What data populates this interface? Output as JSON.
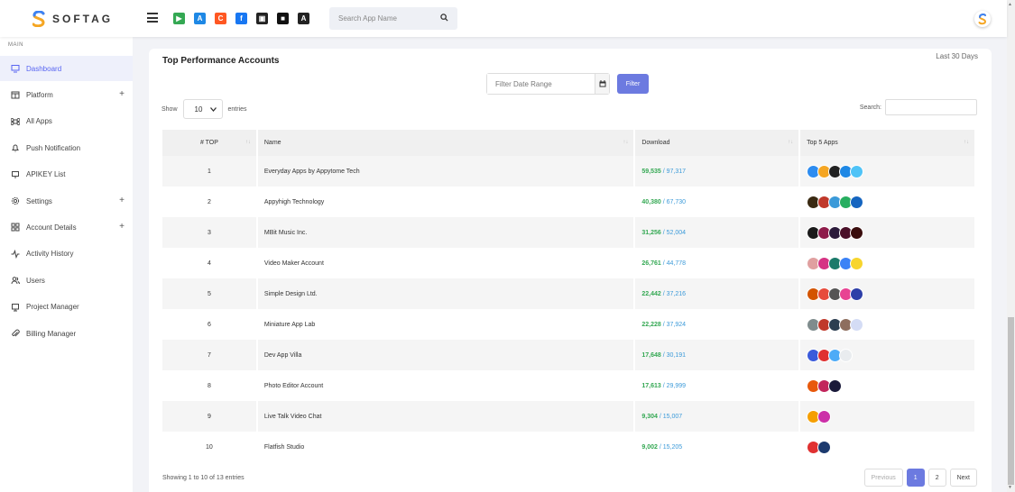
{
  "brand": {
    "name": "SOFTAG"
  },
  "header": {
    "search_placeholder": "Search App Name",
    "store_icons": [
      {
        "name": "google-play-icon",
        "color": "#34a853",
        "glyph": "▶"
      },
      {
        "name": "app-store-icon",
        "color": "#1e88e5",
        "glyph": "A"
      },
      {
        "name": "appgallery-icon",
        "color": "#ff5722",
        "glyph": "C"
      },
      {
        "name": "facebook-icon",
        "color": "#1877f2",
        "glyph": "f"
      },
      {
        "name": "windows-store-icon",
        "color": "#222222",
        "glyph": "▣"
      },
      {
        "name": "store-icon",
        "color": "#111111",
        "glyph": "■"
      },
      {
        "name": "amazon-store-icon",
        "color": "#222222",
        "glyph": "A"
      }
    ]
  },
  "sidebar": {
    "section": "MAIN",
    "items": [
      {
        "label": "Dashboard",
        "icon": "monitor-icon",
        "active": true,
        "expand": ""
      },
      {
        "label": "Platform",
        "icon": "grid-icon",
        "active": false,
        "expand": "+"
      },
      {
        "label": "All Apps",
        "icon": "command-icon",
        "active": false,
        "expand": ""
      },
      {
        "label": "Push Notification",
        "icon": "bell-icon",
        "active": false,
        "expand": ""
      },
      {
        "label": "APIKEY List",
        "icon": "key-icon",
        "active": false,
        "expand": ""
      },
      {
        "label": "Settings",
        "icon": "gear-icon",
        "active": false,
        "expand": "+"
      },
      {
        "label": "Account Details",
        "icon": "layout-icon",
        "active": false,
        "expand": "+"
      },
      {
        "label": "Activity History",
        "icon": "activity-icon",
        "active": false,
        "expand": ""
      },
      {
        "label": "Users",
        "icon": "users-icon",
        "active": false,
        "expand": ""
      },
      {
        "label": "Project Manager",
        "icon": "clipboard-icon",
        "active": false,
        "expand": ""
      },
      {
        "label": "Billing Manager",
        "icon": "paperclip-icon",
        "active": false,
        "expand": ""
      }
    ]
  },
  "card": {
    "title": "Top Performance Accounts",
    "subtitle": "Last 30 Days",
    "filter_placeholder": "Filter Date Range",
    "filter_button": "Filter",
    "show_label": "Show",
    "entries_value": "10",
    "entries_label": "entries",
    "search_label": "Search:"
  },
  "table": {
    "headers": [
      "# TOP",
      "Name",
      "Download",
      "Top 5 Apps"
    ],
    "rows": [
      {
        "rank": "1",
        "name": "Everyday Apps by Appytome Tech",
        "downloads": "59,535",
        "total": "/ 97,317",
        "apps": [
          "#2d8cf0",
          "#f5a623",
          "#222222",
          "#1e88e5",
          "#4fc3f7"
        ]
      },
      {
        "rank": "2",
        "name": "Appyhigh Technology",
        "downloads": "40,380",
        "total": "/ 67,730",
        "apps": [
          "#3a2a12",
          "#c0392b",
          "#3b9ad9",
          "#27ae60",
          "#1565c0"
        ]
      },
      {
        "rank": "3",
        "name": "MBit Music Inc.",
        "downloads": "31,256",
        "total": "/ 52,004",
        "apps": [
          "#1a1a1a",
          "#8e1b4a",
          "#2b1a3a",
          "#4a1029",
          "#3a0d0d"
        ]
      },
      {
        "rank": "4",
        "name": "Video Maker Account",
        "downloads": "26,761",
        "total": "/ 44,778",
        "apps": [
          "#e0a0a0",
          "#d63384",
          "#1b7a6a",
          "#3b82f6",
          "#f7d52d"
        ]
      },
      {
        "rank": "5",
        "name": "Simple Design Ltd.",
        "downloads": "22,442",
        "total": "/ 37,216",
        "apps": [
          "#d35400",
          "#e74c3c",
          "#555555",
          "#e84393",
          "#2d3ea8"
        ]
      },
      {
        "rank": "6",
        "name": "Miniature App Lab",
        "downloads": "22,228",
        "total": "/ 37,924",
        "apps": [
          "#7f8c8d",
          "#c0392b",
          "#2c3e50",
          "#8e6e5e",
          "#d4dcf5"
        ]
      },
      {
        "rank": "7",
        "name": "Dev App Villa",
        "downloads": "17,648",
        "total": "/ 30,191",
        "apps": [
          "#3b5bdb",
          "#e03131",
          "#4dabf7",
          "#e9ecef"
        ]
      },
      {
        "rank": "8",
        "name": "Photo Editor Account",
        "downloads": "17,613",
        "total": "/ 29,999",
        "apps": [
          "#e8590c",
          "#c2255c",
          "#1a1a3a"
        ]
      },
      {
        "rank": "9",
        "name": "Live Talk Video Chat",
        "downloads": "9,304",
        "total": "/ 15,007",
        "apps": [
          "#f59f00",
          "#cc2fa8"
        ]
      },
      {
        "rank": "10",
        "name": "Flatfish Studio",
        "downloads": "9,002",
        "total": "/ 15,205",
        "apps": [
          "#e03131",
          "#1c3a6e"
        ]
      }
    ]
  },
  "footer": {
    "info": "Showing 1 to 10 of 13 entries",
    "pager": {
      "previous": "Previous",
      "pages": [
        "1",
        "2"
      ],
      "next": "Next"
    }
  }
}
